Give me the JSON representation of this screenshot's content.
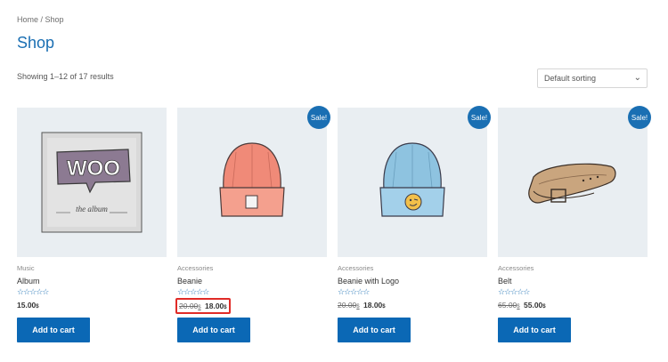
{
  "breadcrumb": {
    "home": "Home",
    "sep": " / ",
    "current": "Shop"
  },
  "page_title": "Shop",
  "result_count": "Showing 1–12 of 17 results",
  "sorting": {
    "selected": "Default sorting",
    "chevron": "⌄"
  },
  "colors": {
    "accent": "#1a6fb3",
    "button": "#0b68b5",
    "highlight": "#e02b27",
    "thumb_bg": "#e9eef2"
  },
  "products": [
    {
      "category": "Music",
      "title": "Album",
      "stars": "☆☆☆☆☆",
      "price": "15.00",
      "currency": "$",
      "button": "Add to cart"
    },
    {
      "category": "Accessories",
      "title": "Beanie",
      "stars": "☆☆☆☆☆",
      "old_price": "20.00",
      "price": "18.00",
      "currency": "$",
      "sale": "Sale!",
      "button": "Add to cart"
    },
    {
      "category": "Accessories",
      "title": "Beanie with Logo",
      "stars": "☆☆☆☆☆",
      "old_price": "20.00",
      "price": "18.00",
      "currency": "$",
      "sale": "Sale!",
      "button": "Add to cart"
    },
    {
      "category": "Accessories",
      "title": "Belt",
      "stars": "☆☆☆☆☆",
      "old_price": "65.00",
      "price": "55.00",
      "currency": "$",
      "sale": "Sale!",
      "button": "Add to cart"
    }
  ],
  "album_art": {
    "logo": "WOO",
    "caption": "the album"
  }
}
